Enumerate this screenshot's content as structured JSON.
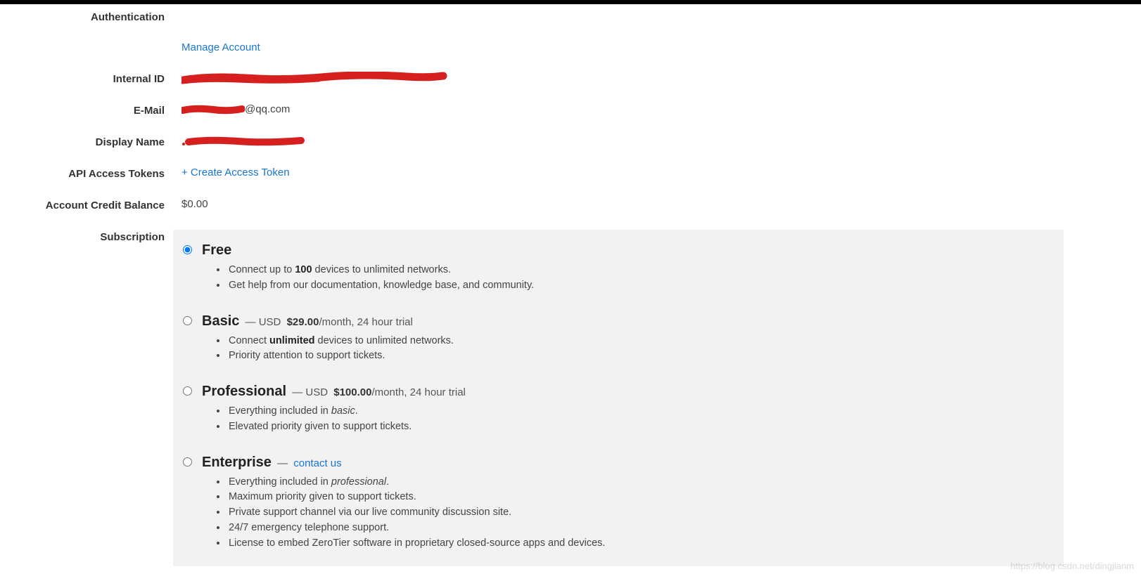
{
  "labels": {
    "authentication": "Authentication",
    "internal_id": "Internal ID",
    "email": "E-Mail",
    "display_name": "Display Name",
    "api_access_tokens": "API Access Tokens",
    "account_credit_balance": "Account Credit Balance",
    "subscription": "Subscription"
  },
  "account": {
    "manage_account_link": "Manage Account",
    "email_suffix": "@qq.com",
    "create_access_token_link": "+ Create Access Token",
    "credit_balance": "$0.00"
  },
  "plans": {
    "free": {
      "title": "Free",
      "selected": true,
      "bullets": {
        "b1_pre": "Connect up to ",
        "b1_bold": "100",
        "b1_post": " devices to unlimited networks.",
        "b2": "Get help from our documentation, knowledge base, and community."
      }
    },
    "basic": {
      "title": "Basic",
      "selected": false,
      "meta_prefix": "— USD ",
      "price": "$29.00",
      "meta_suffix": "/month, 24 hour trial",
      "bullets": {
        "b1_pre": "Connect ",
        "b1_bold": "unlimited",
        "b1_post": " devices to unlimited networks.",
        "b2": "Priority attention to support tickets."
      }
    },
    "professional": {
      "title": "Professional",
      "selected": false,
      "meta_prefix": "— USD ",
      "price": "$100.00",
      "meta_suffix": "/month, 24 hour trial",
      "bullets": {
        "b1_pre": "Everything included in ",
        "b1_em": "basic",
        "b1_post": ".",
        "b2": "Elevated priority given to support tickets."
      }
    },
    "enterprise": {
      "title": "Enterprise",
      "selected": false,
      "meta_prefix": "— ",
      "contact_us": "contact us",
      "bullets": {
        "b1_pre": "Everything included in ",
        "b1_em": "professional",
        "b1_post": ".",
        "b2": "Maximum priority given to support tickets.",
        "b3": "Private support channel via our live community discussion site.",
        "b4": "24/7 emergency telephone support.",
        "b5": "License to embed ZeroTier software in proprietary closed-source apps and devices."
      }
    }
  },
  "watermark": "https://blog.csdn.net/dingjianm"
}
